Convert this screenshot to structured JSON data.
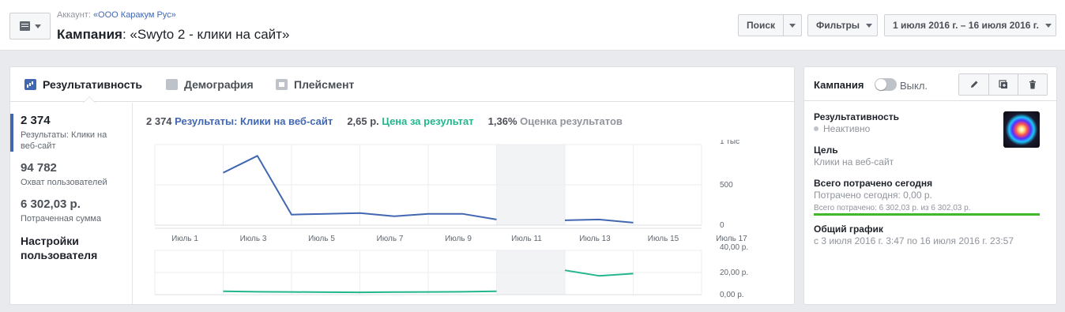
{
  "header": {
    "account_prefix": "Аккаунт:",
    "account_name": "«ООО Каракум Рус»",
    "title_prefix": "Кампания",
    "title_name": ": «Swyto 2 - клики на сайт»",
    "search_label": "Поиск",
    "filters_label": "Фильтры",
    "date_range": "1 июля 2016 г. – 16 июля 2016 г."
  },
  "tabs": [
    {
      "label": "Результативность",
      "icon": "bar-chart-icon"
    },
    {
      "label": "Демография",
      "icon": "people-icon"
    },
    {
      "label": "Плейсмент",
      "icon": "placement-icon"
    }
  ],
  "metrics": [
    {
      "value": "2 374",
      "label": "Результаты: Клики на веб-сайт"
    },
    {
      "value": "94 782",
      "label": "Охват пользователей"
    },
    {
      "value": "6 302,03 р.",
      "label": "Потраченная сумма"
    }
  ],
  "user_settings": "Настройки пользователя",
  "summary": {
    "results_count": "2 374",
    "results_label": "Результаты: Клики на веб-сайт",
    "cost_value": "2,65 р.",
    "cost_label": "Цена за результат",
    "rate_value": "1,36%",
    "rate_label": "Оценка результатов"
  },
  "colors": {
    "results": "#4267b2",
    "cost": "#23b58d",
    "budget_progress": "#42b72a"
  },
  "chart_data": [
    {
      "type": "line",
      "x": [
        "Июль 1",
        "Июль 2",
        "Июль 3",
        "Июль 4",
        "Июль 5",
        "Июль 6",
        "Июль 7",
        "Июль 8",
        "Июль 9",
        "Июль 10",
        "Июль 11",
        "Июль 12",
        "Июль 13",
        "Июль 14",
        "Июль 15",
        "Июль 16",
        "Июль 17"
      ],
      "x_tick_labels": [
        "Июль 1",
        "Июль 3",
        "Июль 5",
        "Июль 7",
        "Июль 9",
        "Июль 11",
        "Июль 13",
        "Июль 15",
        "Июль 17"
      ],
      "y_tick_labels": [
        "1 тыс",
        "500",
        "0"
      ],
      "ylim": [
        0,
        1000
      ],
      "shaded_period": [
        "Июль 11",
        "Июль 13"
      ],
      "series": [
        {
          "values": [
            null,
            null,
            650,
            860,
            130,
            140,
            150,
            110,
            140,
            140,
            70,
            null,
            60,
            70,
            30,
            null,
            null
          ]
        }
      ]
    },
    {
      "type": "line",
      "x": [
        "Июль 1",
        "Июль 2",
        "Июль 3",
        "Июль 4",
        "Июль 5",
        "Июль 6",
        "Июль 7",
        "Июль 8",
        "Июль 9",
        "Июль 10",
        "Июль 11",
        "Июль 12",
        "Июль 13",
        "Июль 14",
        "Июль 15",
        "Июль 16",
        "Июль 17"
      ],
      "y_tick_labels": [
        "40,00 р.",
        "20,00 р.",
        "0,00 р."
      ],
      "ylim": [
        0,
        40
      ],
      "shaded_period": [
        "Июль 11",
        "Июль 13"
      ],
      "series": [
        {
          "values": [
            null,
            null,
            3,
            2.6,
            2.4,
            2.2,
            2.1,
            2.3,
            2.4,
            2.6,
            3.0,
            null,
            22,
            17,
            19,
            null,
            null
          ]
        }
      ]
    }
  ],
  "side": {
    "title": "Кампания",
    "toggle_label": "Выкл.",
    "performance_label": "Результативность",
    "performance_status": "Неактивно",
    "goal_label": "Цель",
    "goal_value": "Клики на веб-сайт",
    "spent_label": "Всего потрачено сегодня",
    "spent_today": "Потрачено сегодня: 0,00 р.",
    "spent_total": "Всего потрачено: 6 302,03 р. из 6 302,03 р.",
    "spent_fraction": 1.0,
    "schedule_label": "Общий график",
    "schedule_value": "с 3 июля 2016 г. 3:47 по 16 июля 2016 г. 23:57"
  }
}
